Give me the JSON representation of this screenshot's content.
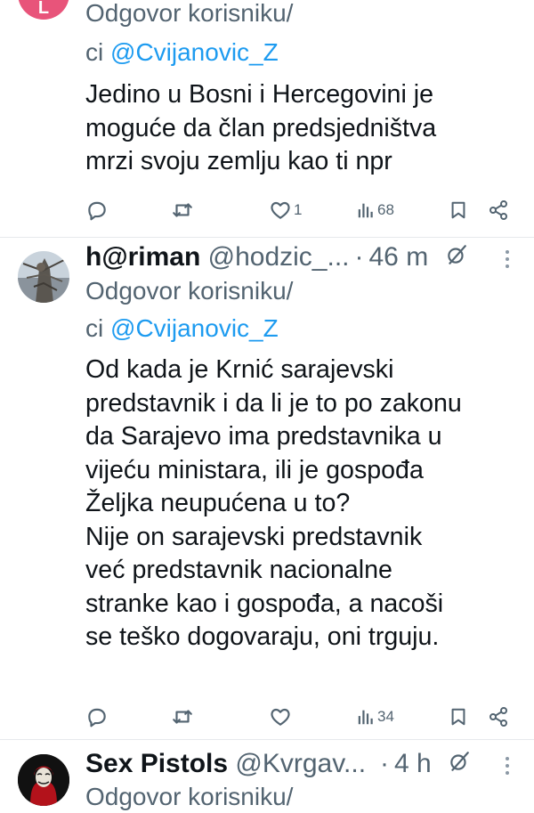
{
  "tweets": [
    {
      "avatar_letter": "L",
      "avatar_color": "#e8547a",
      "reply_prefix": "Odgovor korisniku/",
      "reply_suffix": "ci",
      "reply_to": "@Cvijanovic_Z",
      "text": [
        "Jedino u Bosni i Hercegovini je",
        "moguće da član predsjedništva",
        "mrzi svoju zemlju kao ti npr"
      ],
      "likes": "1",
      "views": "68"
    },
    {
      "display_name": "h@riman",
      "handle": "@hodzic_...",
      "separator": "·",
      "time": "46 m",
      "reply_prefix": "Odgovor korisniku/",
      "reply_suffix": "ci",
      "reply_to": "@Cvijanovic_Z",
      "text": [
        "Od kada je Krnić sarajevski",
        "predstavnik i da li je to po zakonu",
        "da Sarajevo ima predstavnika u",
        "vijeću ministara, ili je gospođa",
        "Željka neupućena u to?",
        "Nije on sarajevski predstavnik",
        "već predstavnik nacionalne",
        "stranke kao i gospođa, a nacoši",
        "se teško dogovaraju, oni trguju."
      ],
      "views": "34"
    },
    {
      "display_name": "Sex Pistols",
      "handle": "@Kvrgav...",
      "separator": "·",
      "time": "4 h",
      "reply_prefix": "Odgovor korisniku/"
    }
  ],
  "icons": [
    "reply-icon",
    "retweet-icon",
    "like-icon",
    "views-icon",
    "bookmark-icon",
    "share-icon",
    "grok-icon",
    "more-icon"
  ],
  "colors": {
    "mention": "#1d9bf0",
    "secondary_text": "#536471",
    "primary_text": "#0f1419"
  }
}
